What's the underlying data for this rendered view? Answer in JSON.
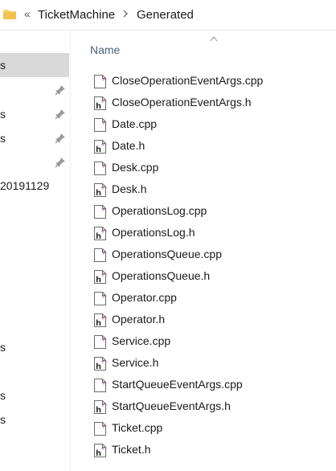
{
  "address_bar": {
    "overflow": "«",
    "crumbs": [
      "TicketMachine",
      "Generated"
    ]
  },
  "nav": {
    "items": [
      {
        "label": "s",
        "selected": true,
        "pinned": false
      },
      {
        "label": "",
        "selected": false,
        "pinned": true
      },
      {
        "label": "s",
        "selected": false,
        "pinned": true
      },
      {
        "label": "s",
        "selected": false,
        "pinned": true
      },
      {
        "label": "",
        "selected": false,
        "pinned": true
      },
      {
        "label": "20191129",
        "selected": false,
        "pinned": false
      },
      {
        "label": "s",
        "selected": false,
        "pinned": false
      },
      {
        "label": "s",
        "selected": false,
        "pinned": false
      },
      {
        "label": "s",
        "selected": false,
        "pinned": false
      }
    ]
  },
  "content": {
    "column_header": "Name",
    "sort": "ascending",
    "files": [
      {
        "name": "CloseOperationEventArgs.cpp",
        "type": "cpp"
      },
      {
        "name": "CloseOperationEventArgs.h",
        "type": "h"
      },
      {
        "name": "Date.cpp",
        "type": "cpp"
      },
      {
        "name": "Date.h",
        "type": "h"
      },
      {
        "name": "Desk.cpp",
        "type": "cpp"
      },
      {
        "name": "Desk.h",
        "type": "h"
      },
      {
        "name": "OperationsLog.cpp",
        "type": "cpp"
      },
      {
        "name": "OperationsLog.h",
        "type": "h"
      },
      {
        "name": "OperationsQueue.cpp",
        "type": "cpp"
      },
      {
        "name": "OperationsQueue.h",
        "type": "h"
      },
      {
        "name": "Operator.cpp",
        "type": "cpp"
      },
      {
        "name": "Operator.h",
        "type": "h"
      },
      {
        "name": "Service.cpp",
        "type": "cpp"
      },
      {
        "name": "Service.h",
        "type": "h"
      },
      {
        "name": "StartQueueEventArgs.cpp",
        "type": "cpp"
      },
      {
        "name": "StartQueueEventArgs.h",
        "type": "h"
      },
      {
        "name": "Ticket.cpp",
        "type": "cpp"
      },
      {
        "name": "Ticket.h",
        "type": "h"
      }
    ]
  },
  "colors": {
    "selected_bg": "#d9d9d9",
    "header_text": "#4c607a",
    "folder_yellow": "#f8d775",
    "file_accent": "#9b4f96"
  }
}
